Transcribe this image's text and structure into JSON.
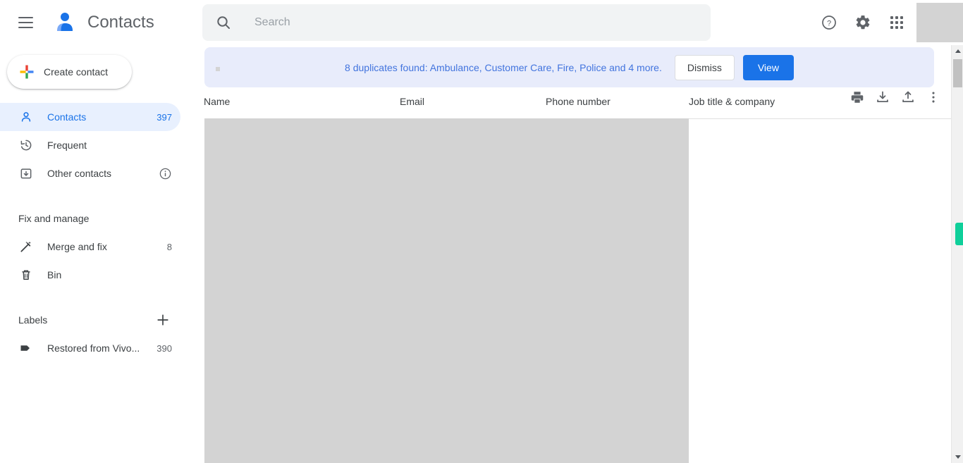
{
  "header": {
    "menu_icon": "hamburger-menu-icon",
    "brand_icon": "contacts-person-logo-icon",
    "title": "Contacts",
    "search": {
      "icon": "search-icon",
      "placeholder": "Search",
      "value": ""
    },
    "actions": [
      {
        "name": "help-icon",
        "label": "Help"
      },
      {
        "name": "settings-gear-icon",
        "label": "Settings"
      },
      {
        "name": "google-apps-grid-icon",
        "label": "Google apps"
      }
    ],
    "avatar": {
      "name": "account-avatar",
      "label": ""
    }
  },
  "sidebar": {
    "create_button": {
      "label": "Create contact",
      "icon": "google-plus-multicolor-icon"
    },
    "nav_items": [
      {
        "label": "Contacts",
        "count": "397",
        "icon": "person-icon",
        "selected": true
      },
      {
        "label": "Frequent",
        "count": "",
        "icon": "history-clock-icon",
        "selected": false
      },
      {
        "label": "Other contacts",
        "count": "",
        "icon": "archive-box-icon",
        "selected": false,
        "info_icon": "info-icon"
      }
    ],
    "fix_section": {
      "title": "Fix and manage",
      "items": [
        {
          "label": "Merge and fix",
          "count": "8",
          "icon": "magic-wand-icon"
        },
        {
          "label": "Bin",
          "count": "",
          "icon": "trash-bin-icon"
        }
      ]
    },
    "labels_section": {
      "title": "Labels",
      "add_icon": "plus-icon",
      "items": [
        {
          "label": "Restored from Vivo...",
          "count": "390",
          "icon": "label-tag-icon"
        }
      ]
    }
  },
  "main": {
    "banner": {
      "text": "8 duplicates found: Ambulance, Customer Care, Fire, Police and 4 more.",
      "dismiss_label": "Dismiss",
      "view_label": "View"
    },
    "table": {
      "columns": [
        "Name",
        "Email",
        "Phone number",
        "Job title & company"
      ],
      "rows": [],
      "tools": [
        {
          "name": "print-icon",
          "label": "Print"
        },
        {
          "name": "download-export-icon",
          "label": "Export"
        },
        {
          "name": "upload-import-icon",
          "label": "Import"
        },
        {
          "name": "more-options-icon",
          "label": "More actions"
        }
      ]
    }
  },
  "scrollbar": {
    "up_icon": "scroll-up-arrow-icon",
    "down_icon": "scroll-down-arrow-icon",
    "thumb": "scrollbar-thumb",
    "marker": "scroll-position-marker"
  },
  "colors": {
    "accent_blue": "#1a73e8",
    "banner_bg": "#e8ecfb",
    "banner_text": "#4274de",
    "selected_nav_bg": "#e8f0fe",
    "marker_green": "#0fcf9a",
    "placeholder_gray": "#d3d3d3"
  }
}
